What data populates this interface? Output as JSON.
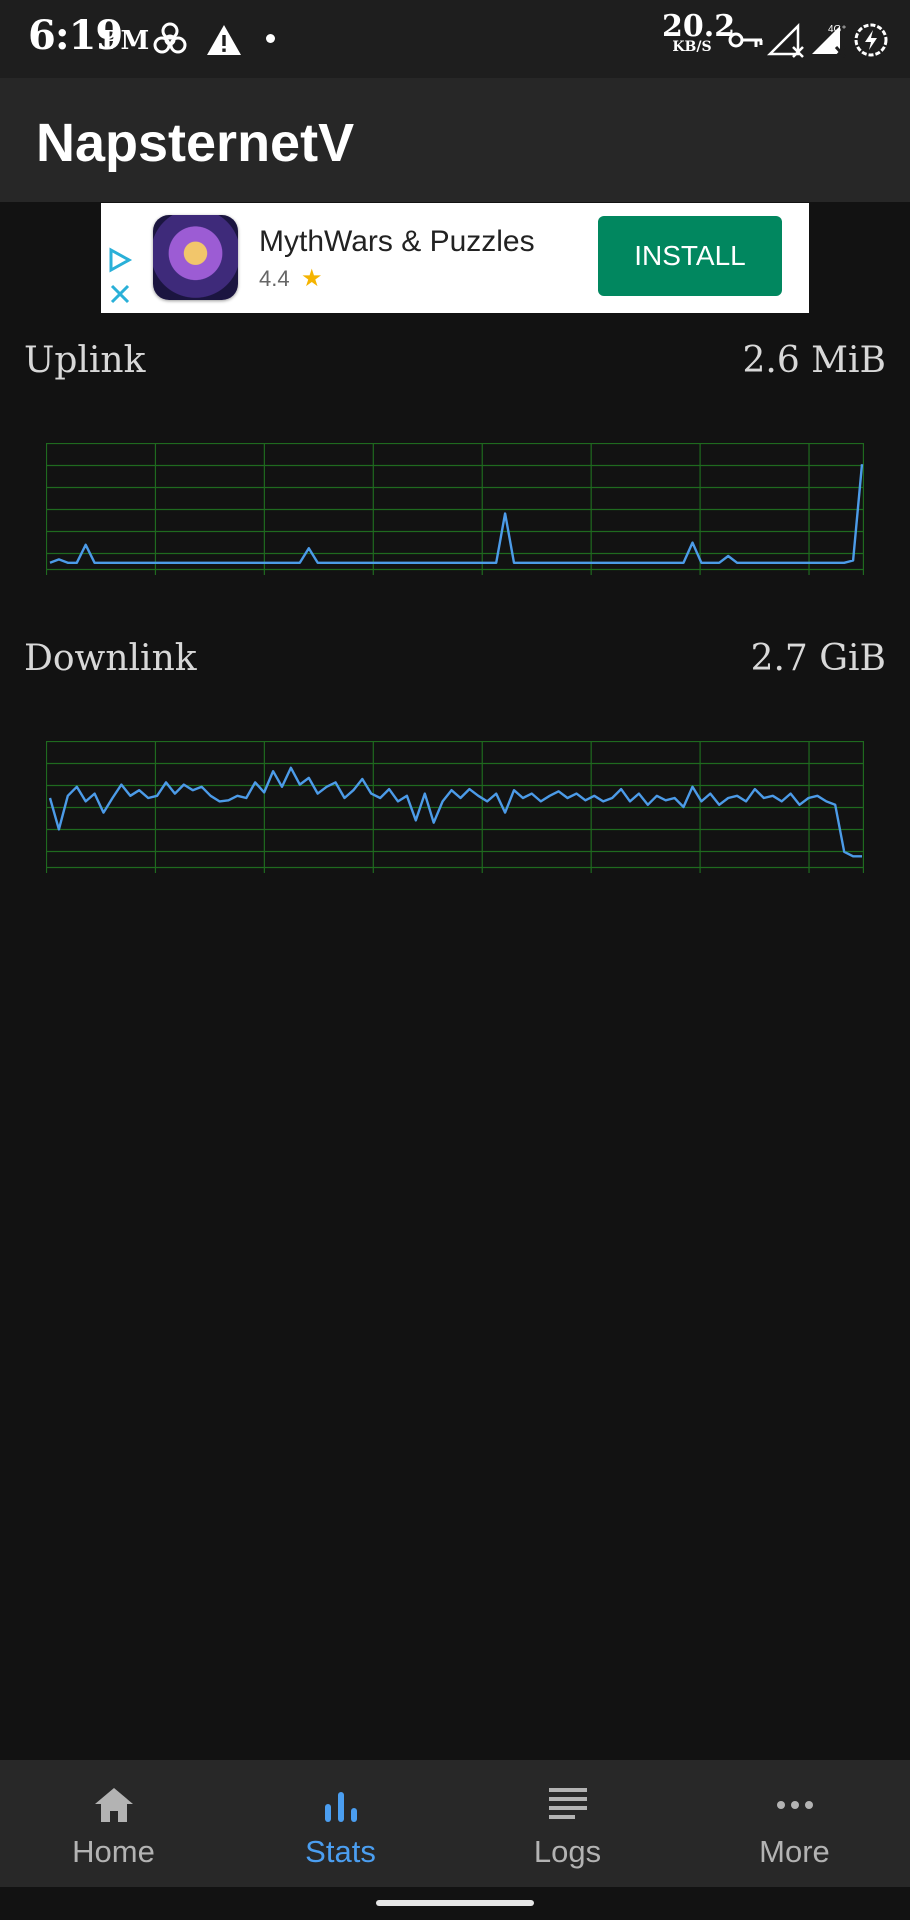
{
  "status_bar": {
    "time": "6:19",
    "ampm": "PM",
    "net_speed_value": "20.2",
    "net_speed_unit": "KB/S",
    "icons": [
      "biohazard-icon",
      "warning-icon",
      "notification-dot",
      "vpn-key-icon",
      "signal-no-sim-icon",
      "signal-4g-icon",
      "battery-saver-icon"
    ]
  },
  "app_bar": {
    "title": "NapsternetV"
  },
  "ad": {
    "title": "MythWars & Puzzles",
    "rating": "4.4",
    "star": "★",
    "install_label": "INSTALL",
    "colors": {
      "install_bg": "#01875f",
      "choices": "#2ab0d8"
    }
  },
  "stats": {
    "uplink": {
      "label": "Uplink",
      "value": "2.6 MiB",
      "series": [
        0.02,
        0.05,
        0.02,
        0.02,
        0.18,
        0.02,
        0.02,
        0.02,
        0.02,
        0.02,
        0.02,
        0.02,
        0.02,
        0.02,
        0.02,
        0.02,
        0.02,
        0.02,
        0.02,
        0.02,
        0.02,
        0.02,
        0.02,
        0.02,
        0.02,
        0.02,
        0.02,
        0.02,
        0.02,
        0.15,
        0.02,
        0.02,
        0.02,
        0.02,
        0.02,
        0.02,
        0.02,
        0.02,
        0.02,
        0.02,
        0.02,
        0.02,
        0.02,
        0.02,
        0.02,
        0.02,
        0.02,
        0.02,
        0.02,
        0.02,
        0.02,
        0.46,
        0.02,
        0.02,
        0.02,
        0.02,
        0.02,
        0.02,
        0.02,
        0.02,
        0.02,
        0.02,
        0.02,
        0.02,
        0.02,
        0.02,
        0.02,
        0.02,
        0.02,
        0.02,
        0.02,
        0.02,
        0.2,
        0.02,
        0.02,
        0.02,
        0.08,
        0.02,
        0.02,
        0.02,
        0.02,
        0.02,
        0.02,
        0.02,
        0.02,
        0.02,
        0.02,
        0.02,
        0.02,
        0.02,
        0.04,
        0.9
      ]
    },
    "downlink": {
      "label": "Downlink",
      "value": "2.7 GiB",
      "series": [
        0.58,
        0.3,
        0.6,
        0.68,
        0.55,
        0.62,
        0.45,
        0.58,
        0.7,
        0.6,
        0.65,
        0.58,
        0.6,
        0.72,
        0.62,
        0.7,
        0.65,
        0.68,
        0.6,
        0.55,
        0.56,
        0.6,
        0.58,
        0.72,
        0.63,
        0.82,
        0.68,
        0.85,
        0.7,
        0.76,
        0.62,
        0.68,
        0.72,
        0.58,
        0.65,
        0.75,
        0.62,
        0.58,
        0.66,
        0.55,
        0.6,
        0.38,
        0.62,
        0.36,
        0.55,
        0.65,
        0.58,
        0.66,
        0.6,
        0.55,
        0.62,
        0.45,
        0.65,
        0.58,
        0.62,
        0.55,
        0.6,
        0.64,
        0.58,
        0.62,
        0.56,
        0.6,
        0.55,
        0.58,
        0.66,
        0.55,
        0.62,
        0.52,
        0.6,
        0.56,
        0.58,
        0.5,
        0.68,
        0.55,
        0.62,
        0.52,
        0.58,
        0.6,
        0.55,
        0.66,
        0.58,
        0.6,
        0.55,
        0.62,
        0.52,
        0.58,
        0.6,
        0.55,
        0.52,
        0.1,
        0.06,
        0.06
      ]
    },
    "colors": {
      "grid": "#1f6a1f",
      "line": "#4c9be8"
    }
  },
  "bottom_nav": {
    "items": [
      {
        "label": "Home",
        "icon": "home-icon",
        "active": false
      },
      {
        "label": "Stats",
        "icon": "bar-chart-icon",
        "active": true
      },
      {
        "label": "Logs",
        "icon": "logs-icon",
        "active": false
      },
      {
        "label": "More",
        "icon": "more-horiz-icon",
        "active": false
      }
    ],
    "colors": {
      "active": "#4b9ef0",
      "inactive": "#b3b3b3"
    }
  }
}
